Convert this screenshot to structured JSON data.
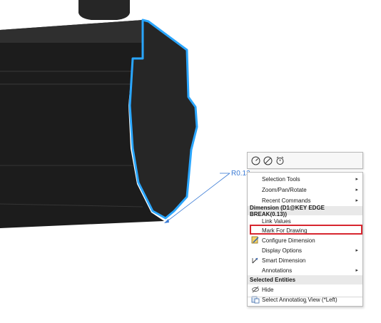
{
  "dimension_label": "R0.13",
  "toolbar": {
    "buttons": [
      "smart-dimension-icon",
      "no-drag-icon",
      "alarm-icon"
    ]
  },
  "menu": {
    "items": [
      {
        "label": "Selection Tools",
        "submenu": true
      },
      {
        "label": "Zoom/Pan/Rotate",
        "submenu": true
      },
      {
        "label": "Recent Commands",
        "submenu": true
      }
    ],
    "dimension_header": "Dimension (D1@KEY EDGE BREAK(0.13))",
    "dimension_items": [
      {
        "label": "Link Values",
        "submenu": false
      },
      {
        "label": "Mark For Drawing",
        "submenu": false
      },
      {
        "label": "Configure Dimension",
        "submenu": false
      },
      {
        "label": "Display Options",
        "submenu": true
      },
      {
        "label": "Smart Dimension",
        "submenu": false
      },
      {
        "label": "Annotations",
        "submenu": true
      }
    ],
    "entities_header": "Selected Entities",
    "entity_items": [
      {
        "label": "Hide",
        "submenu": false
      },
      {
        "label": "Select Annotation View (*Left)",
        "submenu": false
      }
    ],
    "more_label": "»"
  },
  "colors": {
    "highlight": "#d7262f",
    "edge": "#2aa6ff",
    "part": "#1f1f1f"
  }
}
